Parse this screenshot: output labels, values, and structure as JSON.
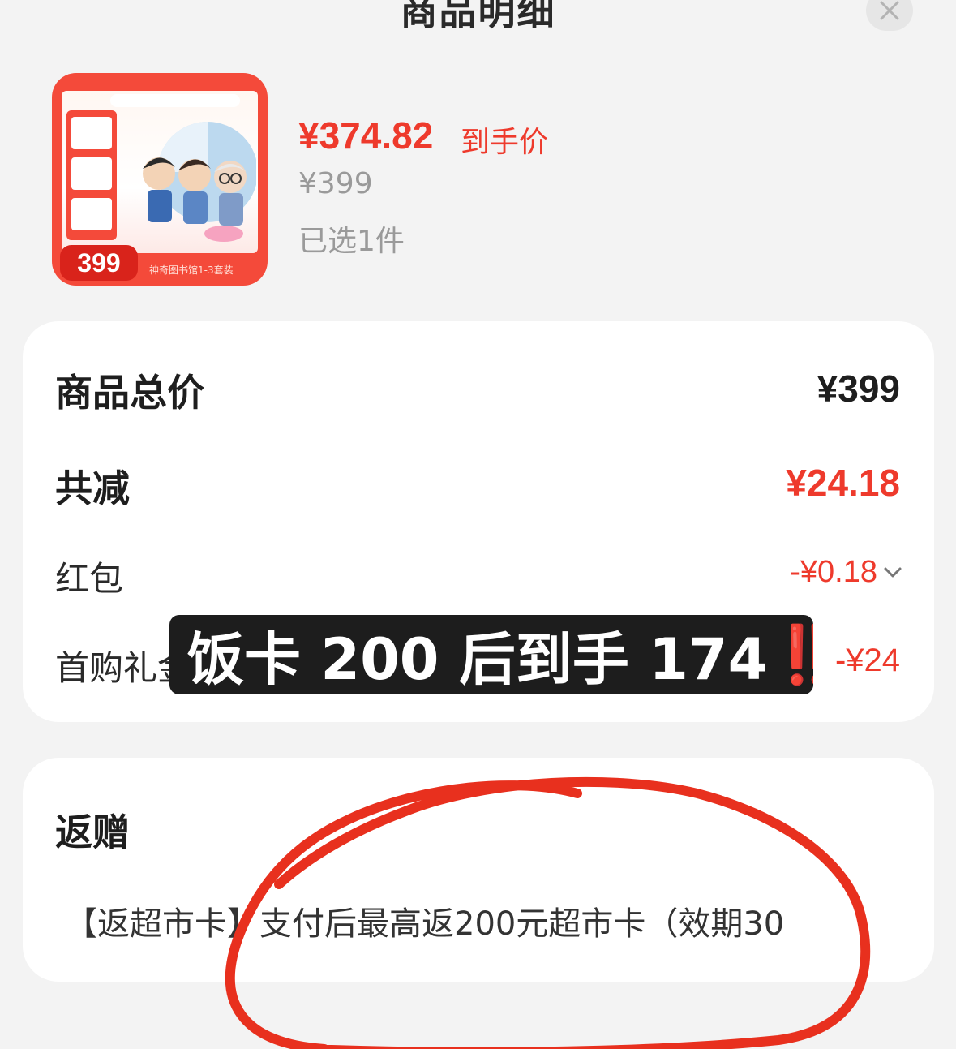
{
  "sheet": {
    "title": "商品明细"
  },
  "product": {
    "thumb_badge": "399",
    "thumb_footer": "神奇图书馆1-3套装",
    "deal_price": "¥374.82",
    "deal_price_label": "到手价",
    "original_price": "¥399",
    "selected_qty": "已选1件"
  },
  "summary": {
    "total_label": "商品总价",
    "total_value": "¥399",
    "saved_label": "共减",
    "saved_value": "¥24.18",
    "redpack_label": "红包",
    "redpack_value": "-¥0.18",
    "first_purchase_label": "首购礼金",
    "first_purchase_value": "-¥24"
  },
  "gift": {
    "title": "返赠",
    "text": "【返超市卡】支付后最高返200元超市卡（效期30"
  },
  "overlay": {
    "caption": "饭卡 200 后到手 174",
    "marks": "‼️",
    "scribble_color": "#e8301e"
  },
  "colors": {
    "accent_red": "#ee3a2c",
    "card_bg": "#ffffff",
    "page_bg": "#f3f3f3"
  },
  "icons": {
    "close": "close-icon",
    "expand": "chevron-down-icon"
  }
}
